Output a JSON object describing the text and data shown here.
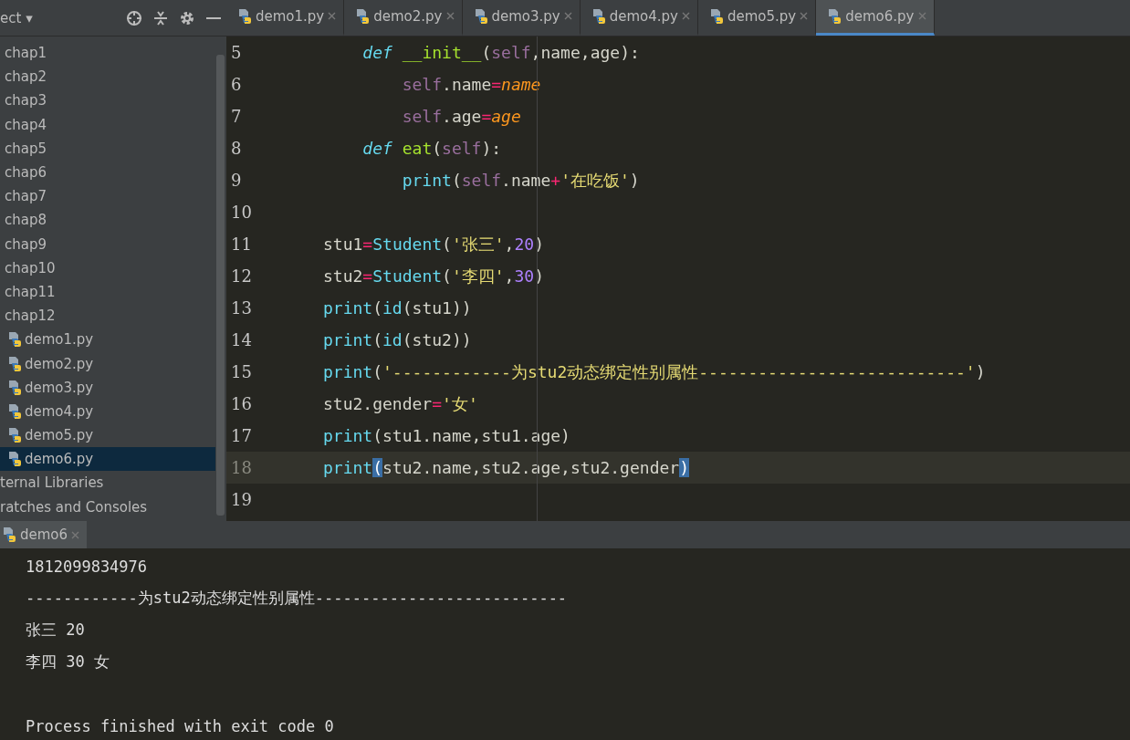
{
  "project_panel": {
    "title": "ect ▾",
    "items": [
      {
        "label": "chap1",
        "kind": "folder",
        "selected": false
      },
      {
        "label": "chap2",
        "kind": "folder",
        "selected": false
      },
      {
        "label": "chap3",
        "kind": "folder",
        "selected": false
      },
      {
        "label": "chap4",
        "kind": "folder",
        "selected": false
      },
      {
        "label": "chap5",
        "kind": "folder",
        "selected": false
      },
      {
        "label": "chap6",
        "kind": "folder",
        "selected": false
      },
      {
        "label": "chap7",
        "kind": "folder",
        "selected": false
      },
      {
        "label": "chap8",
        "kind": "folder",
        "selected": false
      },
      {
        "label": "chap9",
        "kind": "folder",
        "selected": false
      },
      {
        "label": "chap10",
        "kind": "folder",
        "selected": false
      },
      {
        "label": "chap11",
        "kind": "folder",
        "selected": false
      },
      {
        "label": "chap12",
        "kind": "folder",
        "selected": false
      },
      {
        "label": "demo1.py",
        "kind": "file",
        "selected": false
      },
      {
        "label": "demo2.py",
        "kind": "file",
        "selected": false
      },
      {
        "label": "demo3.py",
        "kind": "file",
        "selected": false
      },
      {
        "label": "demo4.py",
        "kind": "file",
        "selected": false
      },
      {
        "label": "demo5.py",
        "kind": "file",
        "selected": false
      },
      {
        "label": "demo6.py",
        "kind": "file",
        "selected": true
      },
      {
        "label": "ternal Libraries",
        "kind": "group",
        "selected": false
      },
      {
        "label": "ratches and Consoles",
        "kind": "group",
        "selected": false
      }
    ]
  },
  "tabs": [
    {
      "label": "demo1.py",
      "selected": false
    },
    {
      "label": "demo2.py",
      "selected": false
    },
    {
      "label": "demo3.py",
      "selected": false
    },
    {
      "label": "demo4.py",
      "selected": false
    },
    {
      "label": "demo5.py",
      "selected": false
    },
    {
      "label": "demo6.py",
      "selected": true
    }
  ],
  "editor": {
    "lines": [
      {
        "number": "5",
        "current": false,
        "tokens": [
          {
            "text": "    def ",
            "kind": "kw"
          },
          {
            "text": "__init__",
            "kind": "fn"
          },
          {
            "text": "(",
            "kind": "plain"
          },
          {
            "text": "self",
            "kind": "self"
          },
          {
            "text": ",name,age):",
            "kind": "plain"
          }
        ]
      },
      {
        "number": "6",
        "current": false,
        "tokens": [
          {
            "text": "        self",
            "kind": "self"
          },
          {
            "text": ".name",
            "kind": "plain"
          },
          {
            "text": "=",
            "kind": "op"
          },
          {
            "text": "name",
            "kind": "param"
          }
        ]
      },
      {
        "number": "7",
        "current": false,
        "tokens": [
          {
            "text": "        self",
            "kind": "self"
          },
          {
            "text": ".age",
            "kind": "plain"
          },
          {
            "text": "=",
            "kind": "op"
          },
          {
            "text": "age",
            "kind": "param"
          }
        ]
      },
      {
        "number": "8",
        "current": false,
        "tokens": [
          {
            "text": "    def ",
            "kind": "kw"
          },
          {
            "text": "eat",
            "kind": "fn"
          },
          {
            "text": "(",
            "kind": "plain"
          },
          {
            "text": "self",
            "kind": "self"
          },
          {
            "text": "):",
            "kind": "plain"
          }
        ]
      },
      {
        "number": "9",
        "current": false,
        "tokens": [
          {
            "text": "        print",
            "kind": "builtin"
          },
          {
            "text": "(",
            "kind": "plain"
          },
          {
            "text": "self",
            "kind": "self"
          },
          {
            "text": ".name",
            "kind": "plain"
          },
          {
            "text": "+",
            "kind": "op"
          },
          {
            "text": "'在吃饭'",
            "kind": "str"
          },
          {
            "text": ")",
            "kind": "plain"
          }
        ]
      },
      {
        "number": "10",
        "current": false
      },
      {
        "number": "11",
        "current": false,
        "tokens": [
          {
            "text": "stu1",
            "kind": "plain"
          },
          {
            "text": "=",
            "kind": "op"
          },
          {
            "text": "Student",
            "kind": "builtin"
          },
          {
            "text": "(",
            "kind": "plain"
          },
          {
            "text": "'张三'",
            "kind": "str"
          },
          {
            "text": ",",
            "kind": "plain"
          },
          {
            "text": "20",
            "kind": "num"
          },
          {
            "text": ")",
            "kind": "plain"
          }
        ]
      },
      {
        "number": "12",
        "current": false,
        "tokens": [
          {
            "text": "stu2",
            "kind": "plain"
          },
          {
            "text": "=",
            "kind": "op"
          },
          {
            "text": "Student",
            "kind": "builtin"
          },
          {
            "text": "(",
            "kind": "plain"
          },
          {
            "text": "'李四'",
            "kind": "str"
          },
          {
            "text": ",",
            "kind": "plain"
          },
          {
            "text": "30",
            "kind": "num"
          },
          {
            "text": ")",
            "kind": "plain"
          }
        ]
      },
      {
        "number": "13",
        "current": false,
        "tokens": [
          {
            "text": "print",
            "kind": "builtin"
          },
          {
            "text": "(",
            "kind": "plain"
          },
          {
            "text": "id",
            "kind": "builtin"
          },
          {
            "text": "(stu1))",
            "kind": "plain"
          }
        ]
      },
      {
        "number": "14",
        "current": false,
        "tokens": [
          {
            "text": "print",
            "kind": "builtin"
          },
          {
            "text": "(",
            "kind": "plain"
          },
          {
            "text": "id",
            "kind": "builtin"
          },
          {
            "text": "(stu2))",
            "kind": "plain"
          }
        ]
      },
      {
        "number": "15",
        "current": false,
        "tokens": [
          {
            "text": "print",
            "kind": "builtin"
          },
          {
            "text": "(",
            "kind": "plain"
          },
          {
            "text": "'------------为stu2动态绑定性别属性---------------------------'",
            "kind": "str"
          },
          {
            "text": ")",
            "kind": "plain"
          }
        ]
      },
      {
        "number": "16",
        "current": false,
        "tokens": [
          {
            "text": "stu2.gender",
            "kind": "plain"
          },
          {
            "text": "=",
            "kind": "op"
          },
          {
            "text": "'女'",
            "kind": "str"
          }
        ]
      },
      {
        "number": "17",
        "current": false,
        "tokens": [
          {
            "text": "print",
            "kind": "builtin"
          },
          {
            "text": "(stu1.name,stu1.age)",
            "kind": "plain"
          }
        ]
      },
      {
        "number": "18",
        "current": true,
        "tokens": [
          {
            "text": "print",
            "kind": "builtin"
          },
          {
            "text": "(",
            "kind": "match"
          },
          {
            "text": "stu2.name,stu2.age,stu2.gender",
            "kind": "plain"
          },
          {
            "text": ")",
            "kind": "match"
          }
        ]
      },
      {
        "number": "19",
        "current": false
      }
    ]
  },
  "run_panel": {
    "tab": {
      "label": "demo6",
      "selected": true
    },
    "output": [
      {
        "text": "1812099834976",
        "kind": "stdout"
      },
      {
        "text": "------------为stu2动态绑定性别属性---------------------------",
        "kind": "stdout"
      },
      {
        "text": "张三 20",
        "kind": "stdout"
      },
      {
        "text": "李四 30 女",
        "kind": "stdout"
      },
      {
        "text": "Process finished with exit code 0",
        "kind": "status"
      }
    ]
  }
}
